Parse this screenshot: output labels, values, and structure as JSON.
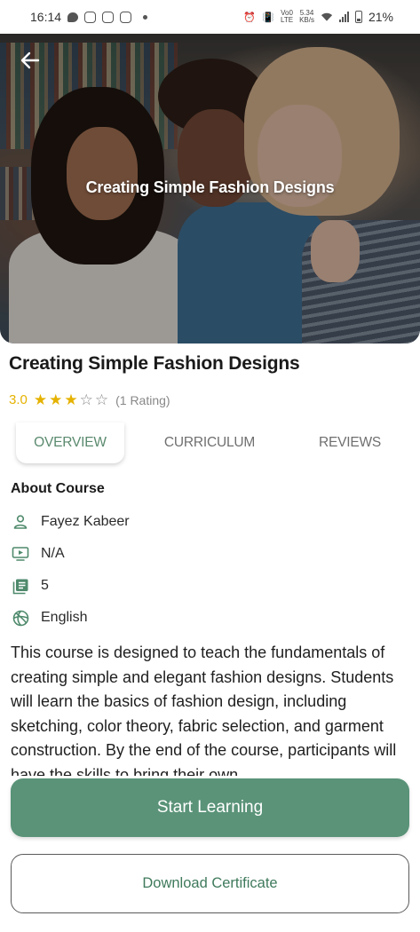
{
  "status_bar": {
    "time": "16:14",
    "network_speed_value": "5.34",
    "network_speed_unit": "KB/s",
    "lte_top": "Vo0",
    "lte_bottom": "LTE",
    "battery": "21%"
  },
  "hero": {
    "overlay_title": "Creating Simple Fashion Designs",
    "back_icon": "arrow-left-icon"
  },
  "course": {
    "title": "Creating Simple Fashion Designs",
    "rating_value": "3.0",
    "stars_filled": 3,
    "stars_total": 5,
    "rating_count": "(1 Rating)",
    "rating_color": "#e5b200"
  },
  "tabs": [
    {
      "label": "OVERVIEW",
      "active": true
    },
    {
      "label": "CURRICULUM",
      "active": false
    },
    {
      "label": "REVIEWS",
      "active": false
    }
  ],
  "about": {
    "heading": "About Course",
    "items": [
      {
        "icon": "person-icon",
        "value": "Fayez Kabeer"
      },
      {
        "icon": "video-icon",
        "value": "N/A"
      },
      {
        "icon": "lessons-icon",
        "value": "5"
      },
      {
        "icon": "language-icon",
        "value": "English"
      }
    ],
    "description": "This course is designed to teach the fundamentals of creating simple and elegant fashion designs. Students will learn the basics of fashion design, including sketching, color theory, fabric selection, and garment construction. By the end of the course, participants will have the skills to bring their own"
  },
  "actions": {
    "start_label": "Start Learning",
    "certificate_label": "Download Certificate",
    "accent_color": "#5a9378"
  }
}
